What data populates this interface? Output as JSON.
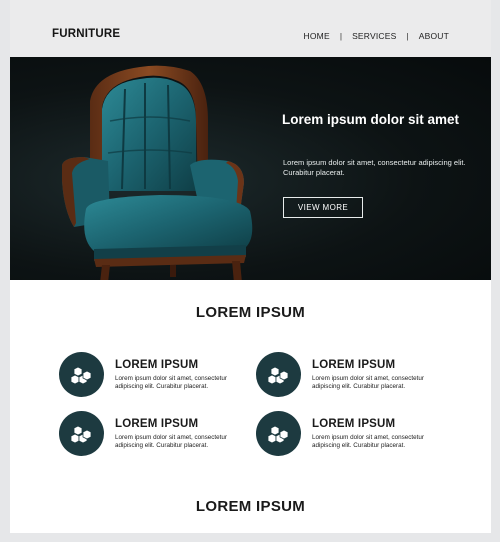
{
  "header": {
    "brand": "FURNITURE",
    "nav": [
      {
        "label": "HOME"
      },
      {
        "label": "SERVICES"
      },
      {
        "label": "ABOUT"
      }
    ],
    "separator": "|"
  },
  "hero": {
    "title": "Lorem ipsum dolor sit amet",
    "text": "Lorem ipsum dolor sit amet, consectetur adipiscing elit. Curabitur placerat.",
    "button_label": "VIEW MORE"
  },
  "section": {
    "title": "LOREM IPSUM",
    "features": [
      {
        "title": "LOREM IPSUM",
        "text": "Lorem ipsum dolor sit amet, consectetur adipiscing elit. Curabitur placerat.",
        "icon": "boxes-icon"
      },
      {
        "title": "LOREM IPSUM",
        "text": "Lorem ipsum dolor sit amet, consectetur adipiscing elit. Curabitur placerat.",
        "icon": "boxes-icon"
      },
      {
        "title": "LOREM IPSUM",
        "text": "Lorem ipsum dolor sit amet, consectetur adipiscing elit. Curabitur placerat.",
        "icon": "boxes-icon"
      },
      {
        "title": "LOREM IPSUM",
        "text": "Lorem ipsum dolor sit amet, consectetur adipiscing elit. Curabitur placerat.",
        "icon": "boxes-icon"
      }
    ]
  },
  "section2": {
    "title": "LOREM IPSUM"
  },
  "colors": {
    "accent": "#1d3a40",
    "header_bg": "#ebebec",
    "hero_bg": "#0d1314"
  }
}
